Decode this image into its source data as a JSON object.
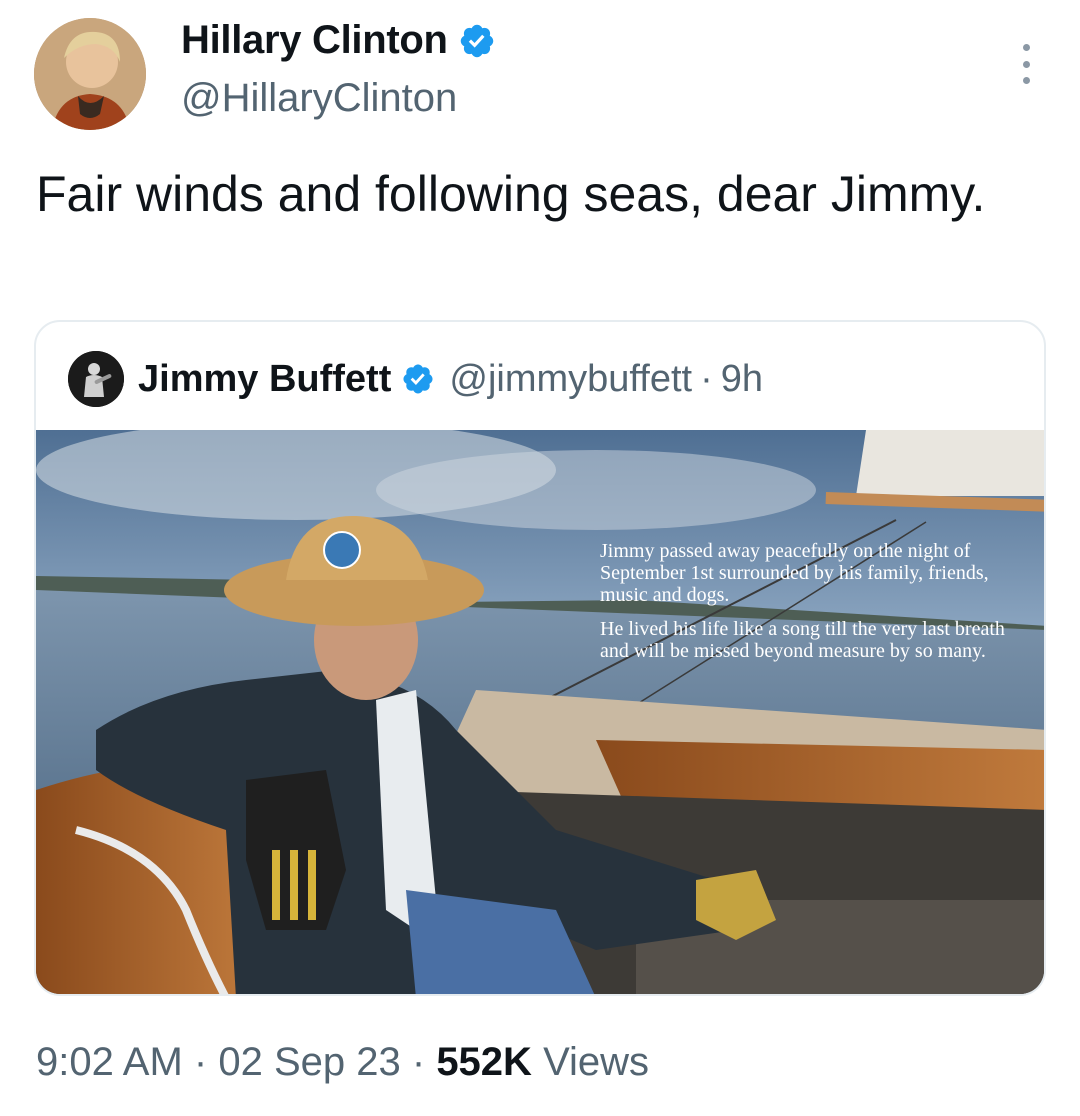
{
  "author": {
    "display_name": "Hillary Clinton",
    "handle": "@HillaryClinton",
    "verified_icon": "verified-badge-icon"
  },
  "tweet": {
    "text": "Fair winds and following seas, dear Jimmy."
  },
  "quoted_tweet": {
    "display_name": "Jimmy Buffett",
    "handle": "@jimmybuffett",
    "separator": "·",
    "time_ago": "9h",
    "image_caption": {
      "paragraph_1": "Jimmy passed away peacefully on the night of September 1st surrounded by his family, friends, music and dogs.",
      "paragraph_2": "He lived his life like a song till the very last breath and will be missed beyond measure by so many."
    }
  },
  "meta": {
    "time": "9:02 AM",
    "date": "02 Sep 23",
    "separator": "·",
    "views_count": "552K",
    "views_label": "Views"
  },
  "colors": {
    "verified_blue": "#1d9bf0",
    "secondary_text": "#536471",
    "primary_text": "#0f1419"
  }
}
